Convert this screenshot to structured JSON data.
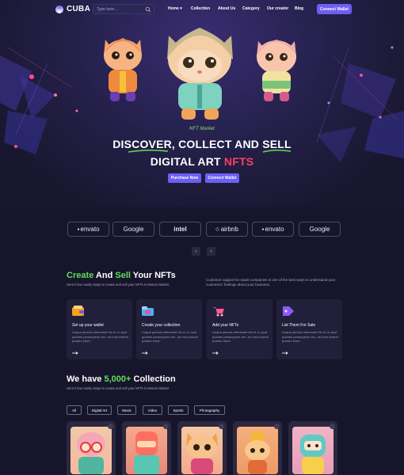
{
  "brand": {
    "name": "CUBA"
  },
  "search": {
    "placeholder": "Type here..."
  },
  "nav": {
    "items": [
      "Home",
      "Collection",
      "About Us",
      "Category",
      "Our creator",
      "Blog"
    ],
    "connect_label": "Connect Wallet"
  },
  "hero": {
    "tagline": "NFT Market",
    "headline_line1": "DISCOVER, COLLECT AND SELL",
    "headline_line2_plain": "DIGITAL ART",
    "headline_line2_highlight": "NFTS",
    "purchase_label": "Purchase Now",
    "connect_label": "Connect Wallet"
  },
  "partners": [
    "envato",
    "Google",
    "intel",
    "airbnb",
    "envato",
    "Google"
  ],
  "create": {
    "title_word1": "Create",
    "title_and": "And",
    "title_word2": "Sell",
    "title_rest": "Your NFTs",
    "subtitle": "Here's four easily steps to create and sell your NFTs in Metoro Market",
    "side_text": "Customer support for SaaS companies is one of the best ways to understand your customers' feelings about your business.",
    "steps": [
      {
        "title": "Set up your wallet",
        "text": "Lisque persius interesset his et, in quot quidam persequeris vim, ad mea essent possim iriure."
      },
      {
        "title": "Create your collection",
        "text": "Lisque persius interesset his et, in quot quidam persequeris vim, ad mea essent possim iriure."
      },
      {
        "title": "Add your NFTs",
        "text": "Lisque persius interesset his et, in quot quidam persequeris vim, ad mea essent possim iriure."
      },
      {
        "title": "List Them For Sale",
        "text": "Lisque persius interesset his et, in quot quidam persequeris vim, ad mea essent possim iriure."
      }
    ]
  },
  "collection": {
    "title_prefix": "We have",
    "count": "5,000+",
    "title_suffix": "Collection",
    "subtitle": "Here's four easily steps to create and sell your NFTs in Metoro Market",
    "filters": [
      "All",
      "Digital Art",
      "Music",
      "Video",
      "Sports",
      "Photography"
    ]
  },
  "colors": {
    "accent": "#6c5ff2",
    "green": "#5ee05a",
    "red": "#ff3f5b",
    "background": "#17152b"
  }
}
